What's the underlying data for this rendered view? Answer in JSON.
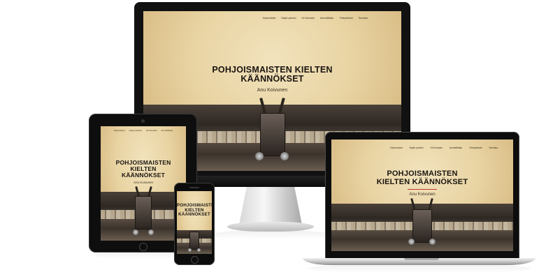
{
  "site": {
    "title_line1": "POHJOISMAISTEN KIELTEN",
    "title_line2": "KÄÄNNÖKSET",
    "title_tablet_line1": "POHJOISMAISTEN",
    "title_tablet_line2": "KIELTEN",
    "title_tablet_line3": "KÄÄNNÖKSET",
    "title_phone_line1": "POHJOISMAISTEN",
    "title_phone_line2": "KIELTEN",
    "title_phone_line3": "KÄÄNNÖKSET",
    "title_laptop_line1": "POHJOISMAISTEN",
    "title_laptop_line2": "KIELTEN KÄÄNNÖKSET",
    "subtitle": "Anu Koivunen",
    "nav": [
      "Kaannokset",
      "Nayte palvelu",
      "Kk hinnasto",
      "Ammattitaito",
      "Yhteystiedot",
      "Svenska"
    ],
    "tablet_nav": [
      "Kaannokset",
      "Nayte palvelu",
      "Kk hinnasto",
      "Ammattitaito"
    ],
    "laptop_nav": [
      "Kaannokset",
      "Nayte palvelu",
      "Kk hinnasto",
      "Ammattitaito",
      "Yhteystiedot",
      "Svenska"
    ]
  },
  "colors": {
    "paper": "#e8d3a2",
    "ink": "#1a1510",
    "accent": "#c0392b",
    "bezel": "#111111"
  }
}
